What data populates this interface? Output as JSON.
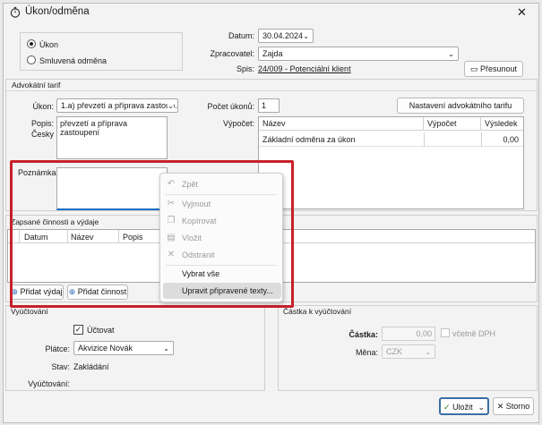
{
  "window": {
    "title": "Úkon/odměna"
  },
  "type_radio": {
    "ukon": "Úkon",
    "smluvena": "Smluvená odměna"
  },
  "header": {
    "datum_label": "Datum:",
    "datum_value": "30.04.2024",
    "zpracovatel_label": "Zpracovatel:",
    "zpracovatel_value": "Zajda",
    "spis_label": "Spis:",
    "spis_value": "24/009 - Potenciální klient",
    "presunout": "Přesunout"
  },
  "tarif": {
    "group_title": "Advokátní tarif",
    "ukon_label": "Úkon:",
    "ukon_value": "1.a) převzetí a příprava zastoup...",
    "pocet_label": "Počet úkonů:",
    "pocet_value": "1",
    "nastaveni": "Nastavení advokátního tarifu",
    "popis_label": "Popis:",
    "cesky_label": "Česky",
    "popis_value": "převzetí a příprava zastoupení",
    "vypocet_label": "Výpočet:",
    "table_headers": [
      "Název",
      "Výpočet",
      "Výsledek"
    ],
    "table_rows": [
      {
        "nazev": "Základní odměna za úkon",
        "vypocet": "",
        "vysledek": "0,00"
      }
    ],
    "poznamka_label": "Poznámka:"
  },
  "cinnosti": {
    "group_title": "Zapsané činnosti a výdaje",
    "columns": [
      "Datum",
      "Název",
      "Popis"
    ],
    "pridat_vydaj": "Přidat výdaj",
    "pridat_cinnost": "Přidat činnost"
  },
  "context_menu": {
    "items": [
      {
        "label": "Zpět",
        "icon": "undo-icon",
        "enabled": false
      },
      {
        "label": "Vyjmout",
        "icon": "scissors-icon",
        "enabled": false
      },
      {
        "label": "Kopírovat",
        "icon": "copy-icon",
        "enabled": false
      },
      {
        "label": "Vložit",
        "icon": "paste-icon",
        "enabled": false
      },
      {
        "label": "Odstranit",
        "icon": "delete-icon",
        "enabled": false
      },
      {
        "label": "Vybrat vše",
        "icon": "",
        "enabled": true
      },
      {
        "label": "Upravit připravené texty...",
        "icon": "",
        "enabled": true,
        "highlighted": true
      }
    ]
  },
  "vyuctovani": {
    "group_title": "Vyúčtování",
    "uctovat": "Účtovat",
    "platce_label": "Plátce:",
    "platce_value": "Akvizice Novák",
    "stav_label": "Stav:",
    "stav_value": "Zakládání",
    "vyuctovani_label": "Vyúčtování:"
  },
  "castka": {
    "group_title": "Částka k vyúčtování",
    "castka_label": "Částka:",
    "castka_value": "0,00",
    "vcetne_dph": "včetně DPH",
    "mena_label": "Měna:",
    "mena_value": "CZK"
  },
  "footer": {
    "ulozit": "Uložit",
    "storno": "Storno"
  },
  "colors": {
    "highlight_frame": "#c8202a",
    "link": "#1a1a1a"
  }
}
